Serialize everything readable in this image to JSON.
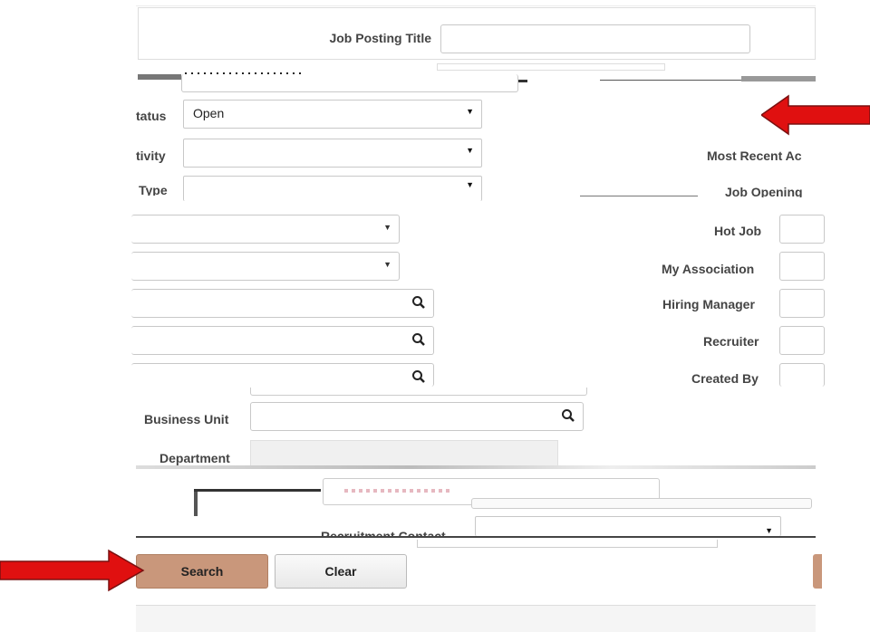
{
  "fields": {
    "job_posting_title": {
      "label": "Job Posting Title",
      "value": ""
    },
    "status": {
      "label": "tatus",
      "value": "Open"
    },
    "activity": {
      "label": "tivity",
      "value": ""
    },
    "type": {
      "label": "Type",
      "value": ""
    },
    "most_recent": {
      "label": "Most Recent Ac"
    },
    "job_opening": {
      "label": "Job Opening"
    },
    "hot_job": {
      "label": "Hot Job"
    },
    "my_association": {
      "label": "My Association"
    },
    "hiring_manager": {
      "label": "Hiring Manager"
    },
    "recruiter": {
      "label": "Recruiter"
    },
    "created_by": {
      "label": "Created By"
    },
    "business_unit": {
      "label": "Business Unit",
      "value": ""
    },
    "department": {
      "label": "Department"
    },
    "recruitment_contact": {
      "label": "Recruitment Contact"
    }
  },
  "buttons": {
    "search": "Search",
    "clear": "Clear"
  },
  "colors": {
    "search_button": "#c9977b",
    "arrow": "#e01010"
  }
}
